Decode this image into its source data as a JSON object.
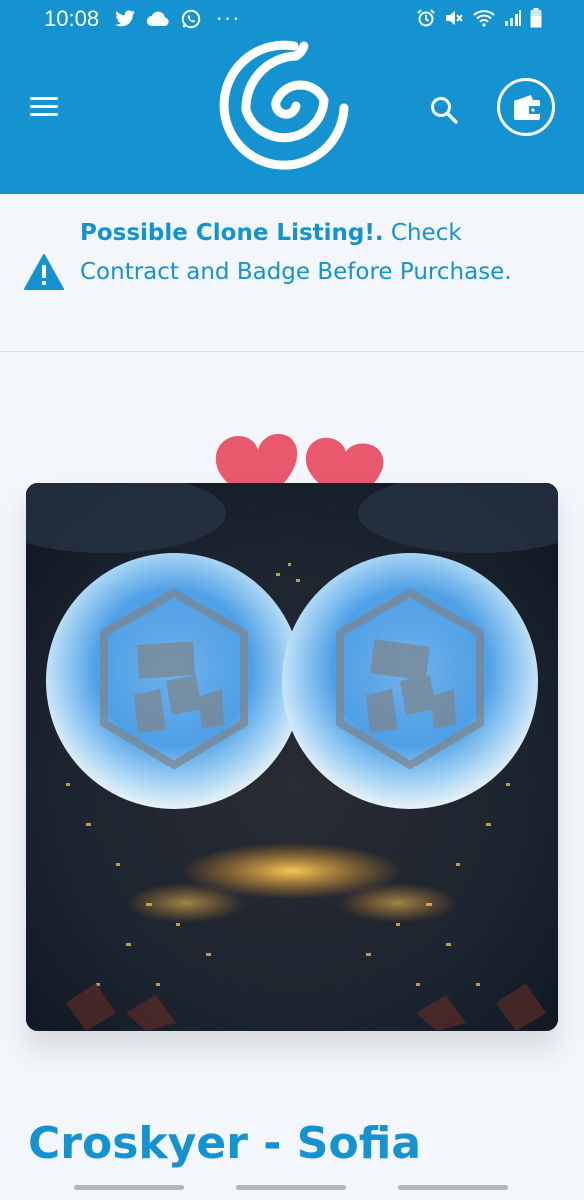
{
  "status_bar": {
    "time": "10:08",
    "left_icons": [
      "twitter-icon",
      "cloud-icon",
      "whatsapp-icon",
      "more-dots-icon"
    ],
    "right_icons": [
      "alarm-icon",
      "mute-icon",
      "wifi-icon",
      "signal-icon",
      "battery-icon"
    ],
    "dots": "···"
  },
  "app_bar": {
    "background": "#1592d0",
    "icons": [
      "menu-icon",
      "app-logo",
      "search-icon",
      "wallet-icon"
    ]
  },
  "warning": {
    "icon": "warning-icon",
    "bold_text": "Possible Clone Listing!.",
    "text": " Check Contract and Badge Before Purchase.",
    "color": "#1592d0"
  },
  "nft": {
    "title": "Croskyer - Sofia",
    "decorations": [
      "heart-icon",
      "heart-icon"
    ],
    "image_description_icon": "crypto-hexagon-logo"
  },
  "colors": {
    "accent": "#1592d0",
    "heart": "#e8596e",
    "background": "#f3f7fb"
  }
}
